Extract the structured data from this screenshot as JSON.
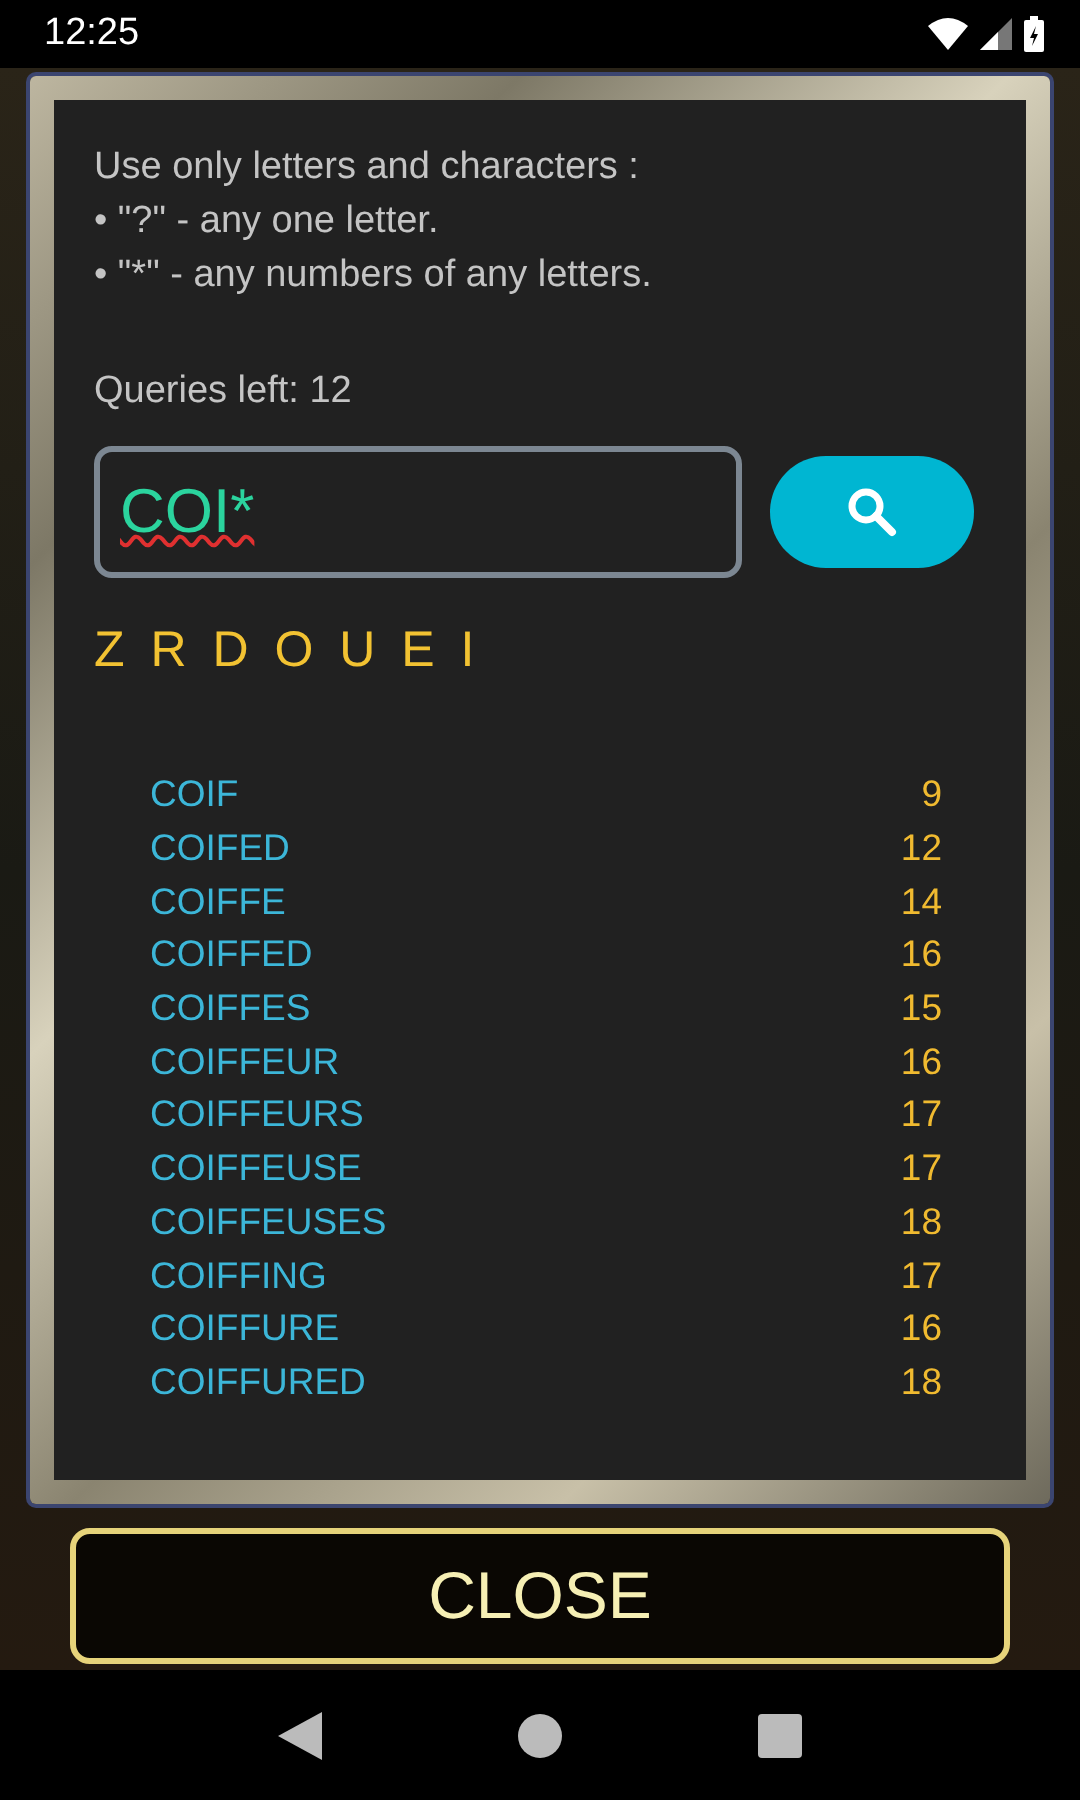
{
  "status_bar": {
    "time": "12:25"
  },
  "dialog": {
    "instructions": [
      "Use only letters and characters :",
      "• \"?\" - any one letter.",
      "• \"*\" - any numbers of any letters."
    ],
    "queries_left": "Queries left: 12",
    "search_field": {
      "value": "COI*"
    },
    "letters": "Z R D O U E I",
    "results": [
      {
        "word": "COIF",
        "score": "9"
      },
      {
        "word": "COIFED",
        "score": "12"
      },
      {
        "word": "COIFFE",
        "score": "14"
      },
      {
        "word": "COIFFED",
        "score": "16"
      },
      {
        "word": "COIFFES",
        "score": "15"
      },
      {
        "word": "COIFFEUR",
        "score": "16"
      },
      {
        "word": "COIFFEURS",
        "score": "17"
      },
      {
        "word": "COIFFEUSE",
        "score": "17"
      },
      {
        "word": "COIFFEUSES",
        "score": "18"
      },
      {
        "word": "COIFFING",
        "score": "17"
      },
      {
        "word": "COIFFURE",
        "score": "16"
      },
      {
        "word": "COIFFURED",
        "score": "18"
      }
    ]
  },
  "close_button": {
    "label": "CLOSE"
  }
}
